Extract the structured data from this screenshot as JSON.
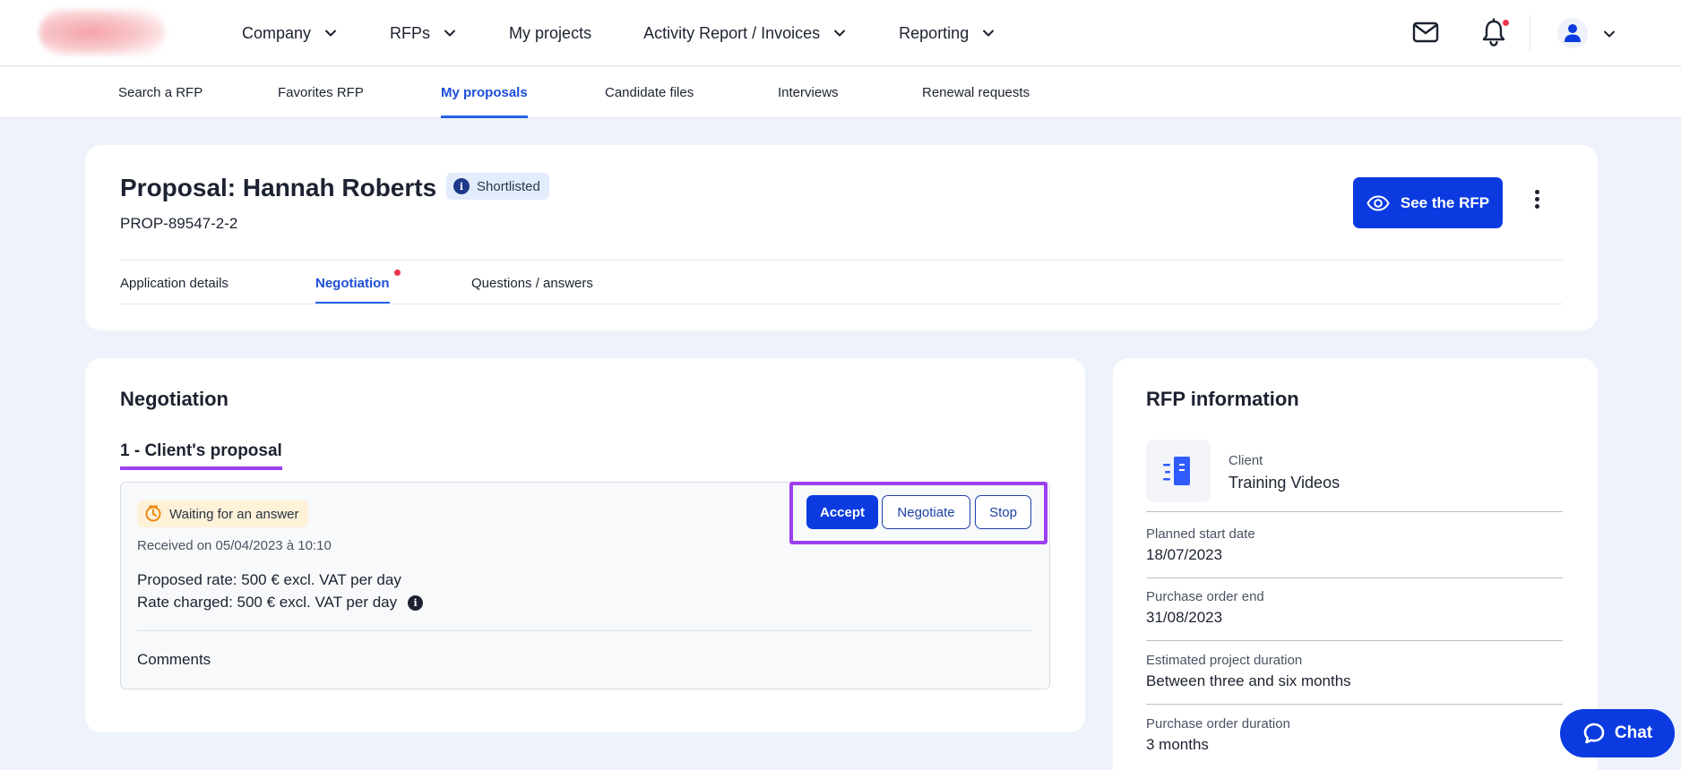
{
  "main_nav": [
    {
      "label": "Company",
      "has_dropdown": true
    },
    {
      "label": "RFPs",
      "has_dropdown": true
    },
    {
      "label": "My projects",
      "has_dropdown": false
    },
    {
      "label": "Activity Report / Invoices",
      "has_dropdown": true
    },
    {
      "label": "Reporting",
      "has_dropdown": true
    }
  ],
  "sub_nav": [
    {
      "label": "Search a RFP"
    },
    {
      "label": "Favorites RFP"
    },
    {
      "label": "My proposals",
      "active": true
    },
    {
      "label": "Candidate files"
    },
    {
      "label": "Interviews"
    },
    {
      "label": "Renewal requests"
    }
  ],
  "header": {
    "title": "Proposal: Hannah Roberts",
    "status": "Shortlisted",
    "reference": "PROP-89547-2-2",
    "see_rfp_label": "See the RFP",
    "tabs": [
      {
        "label": "Application details"
      },
      {
        "label": "Negotiation",
        "active": true,
        "has_notification": true
      },
      {
        "label": "Questions / answers"
      }
    ]
  },
  "negotiation": {
    "title": "Negotiation",
    "section_title": "1 - Client's proposal",
    "status": "Waiting for an answer",
    "received": "Received on 05/04/2023 à 10:10",
    "proposed_rate": "Proposed rate: 500 € excl. VAT per day",
    "rate_charged": "Rate charged: 500 € excl. VAT per day",
    "comments_label": "Comments",
    "actions": {
      "accept": "Accept",
      "negotiate": "Negotiate",
      "stop": "Stop"
    }
  },
  "rfp_info": {
    "title": "RFP information",
    "client_label": "Client",
    "client_name": "Training Videos",
    "rows": [
      {
        "label": "Planned start date",
        "value": "18/07/2023"
      },
      {
        "label": "Purchase order end",
        "value": "31/08/2023"
      },
      {
        "label": "Estimated project duration",
        "value": "Between three and six months"
      },
      {
        "label": "Purchase order duration",
        "value": "3 months"
      }
    ]
  },
  "chat": {
    "label": "Chat"
  },
  "colors": {
    "primary": "#0b3be0",
    "accent_link": "#1d4ed8",
    "highlight": "#9b3ff0",
    "notification": "#e8364a",
    "background": "#eef3fb"
  },
  "icons": [
    "chevron-down-icon",
    "mail-icon",
    "bell-icon",
    "user-icon",
    "eye-icon",
    "more-vertical-icon",
    "info-icon",
    "timer-icon",
    "document-icon",
    "chat-icon"
  ]
}
